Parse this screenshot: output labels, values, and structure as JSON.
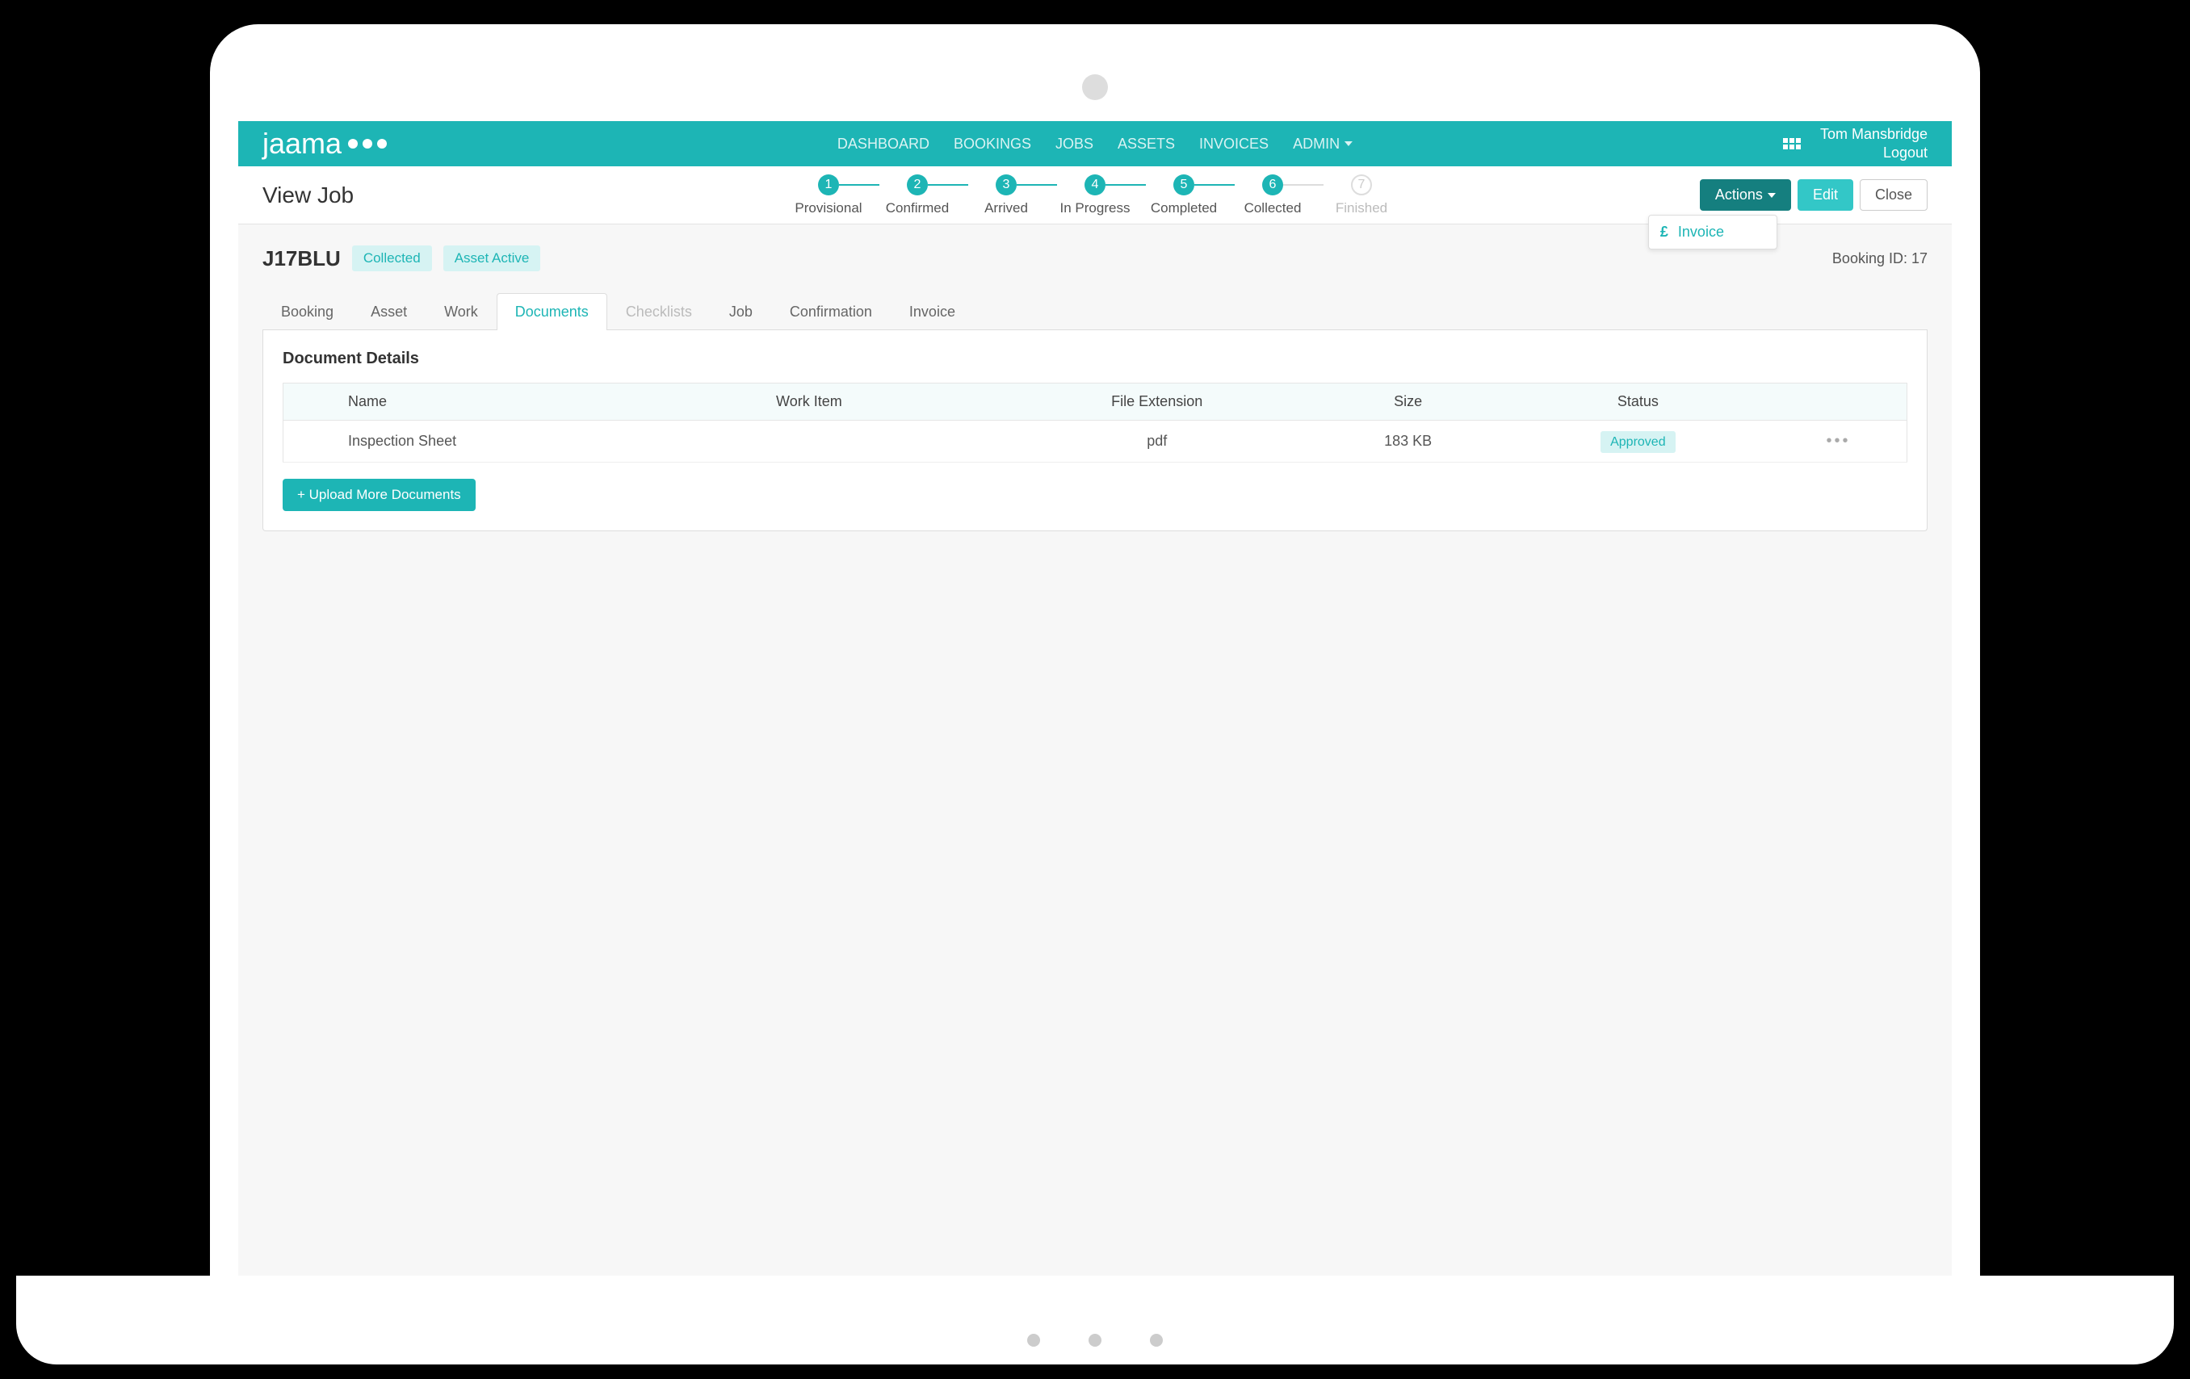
{
  "brand": "jaama",
  "nav": {
    "dashboard": "DASHBOARD",
    "bookings": "BOOKINGS",
    "jobs": "JOBS",
    "assets": "ASSETS",
    "invoices": "INVOICES",
    "admin": "ADMIN"
  },
  "user": {
    "name": "Tom Mansbridge",
    "logout": "Logout"
  },
  "page": {
    "title": "View Job",
    "actions_btn": "Actions",
    "edit_btn": "Edit",
    "close_btn": "Close",
    "dropdown_invoice": "Invoice"
  },
  "steps": [
    {
      "num": "1",
      "label": "Provisional",
      "state": "done"
    },
    {
      "num": "2",
      "label": "Confirmed",
      "state": "done"
    },
    {
      "num": "3",
      "label": "Arrived",
      "state": "done"
    },
    {
      "num": "4",
      "label": "In Progress",
      "state": "done"
    },
    {
      "num": "5",
      "label": "Completed",
      "state": "done"
    },
    {
      "num": "6",
      "label": "Collected",
      "state": "done"
    },
    {
      "num": "7",
      "label": "Finished",
      "state": "disabled"
    }
  ],
  "job": {
    "reference": "J17BLU",
    "status_badge": "Collected",
    "asset_badge": "Asset Active",
    "booking_id_label": "Booking ID: 17"
  },
  "tabs": {
    "booking": "Booking",
    "asset": "Asset",
    "work": "Work",
    "documents": "Documents",
    "checklists": "Checklists",
    "job": "Job",
    "confirmation": "Confirmation",
    "invoice": "Invoice"
  },
  "documents": {
    "panel_title": "Document Details",
    "columns": {
      "name": "Name",
      "work_item": "Work Item",
      "file_ext": "File Extension",
      "size": "Size",
      "status": "Status"
    },
    "rows": [
      {
        "name": "Inspection Sheet",
        "work_item": "",
        "file_ext": "pdf",
        "size": "183 KB",
        "status": "Approved"
      }
    ],
    "upload_btn": "+ Upload More Documents"
  }
}
